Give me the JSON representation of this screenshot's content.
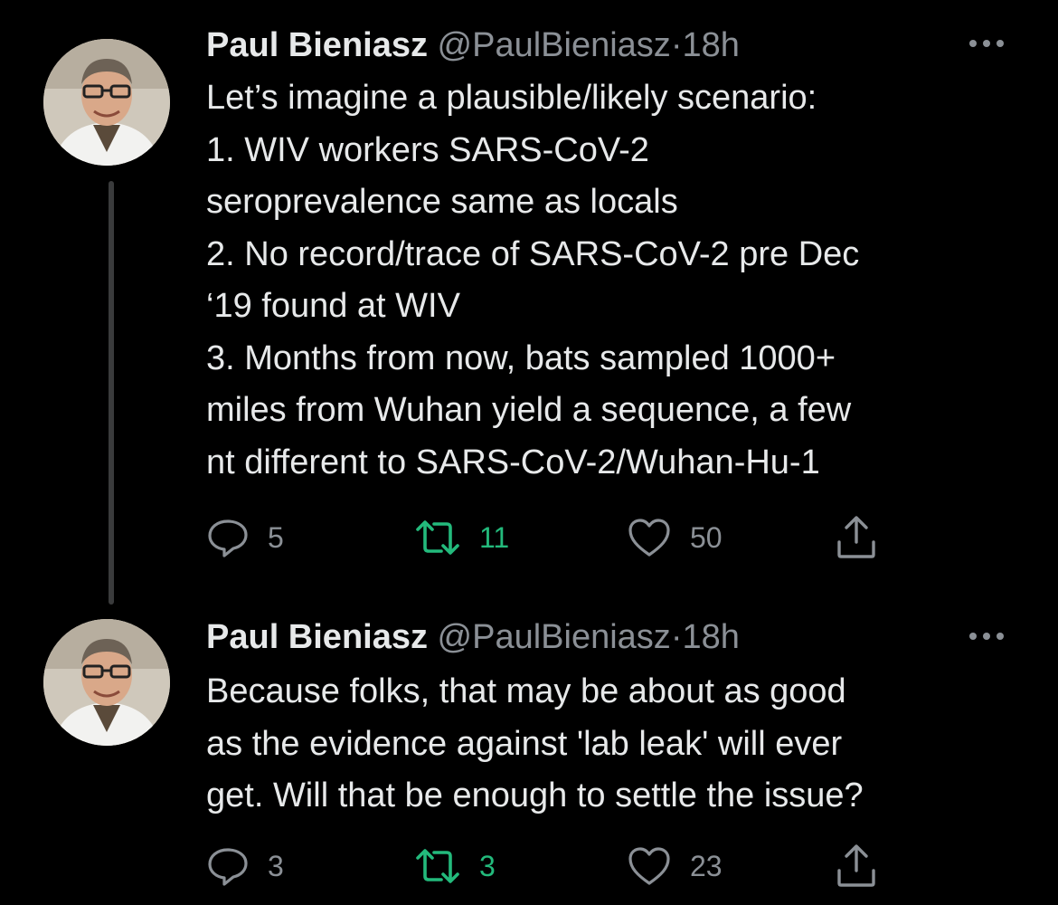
{
  "tweets": [
    {
      "author": "Paul Bieniasz",
      "handle": "@PaulBieniasz",
      "separator": "·",
      "time": "18h",
      "lines": [
        "Let’s imagine a plausible/likely scenario:",
        "1. WIV workers SARS-CoV-2",
        "seroprevalence same as locals",
        "2. No record/trace of SARS-CoV-2 pre Dec",
        "‘19 found at WIV",
        "3. Months from now, bats sampled 1000+",
        "miles from Wuhan yield a sequence, a few",
        "nt different to SARS-CoV-2/Wuhan-Hu-1"
      ],
      "replies": "5",
      "retweets": "11",
      "likes": "50"
    },
    {
      "author": "Paul Bieniasz",
      "handle": "@PaulBieniasz",
      "separator": "·",
      "time": "18h",
      "lines": [
        "Because folks, that may be about as good",
        "as the evidence against 'lab leak' will ever",
        "get. Will that be enough to settle the issue?"
      ],
      "replies": "3",
      "retweets": "3",
      "likes": "23"
    }
  ],
  "colors": {
    "background": "#000000",
    "text": "#e7e9ea",
    "muted": "#8b9096",
    "retweet_active": "#23ba7c",
    "thread_line": "#3a3b3c"
  },
  "icons": [
    "more-icon",
    "reply-icon",
    "retweet-icon",
    "like-icon",
    "share-icon"
  ]
}
